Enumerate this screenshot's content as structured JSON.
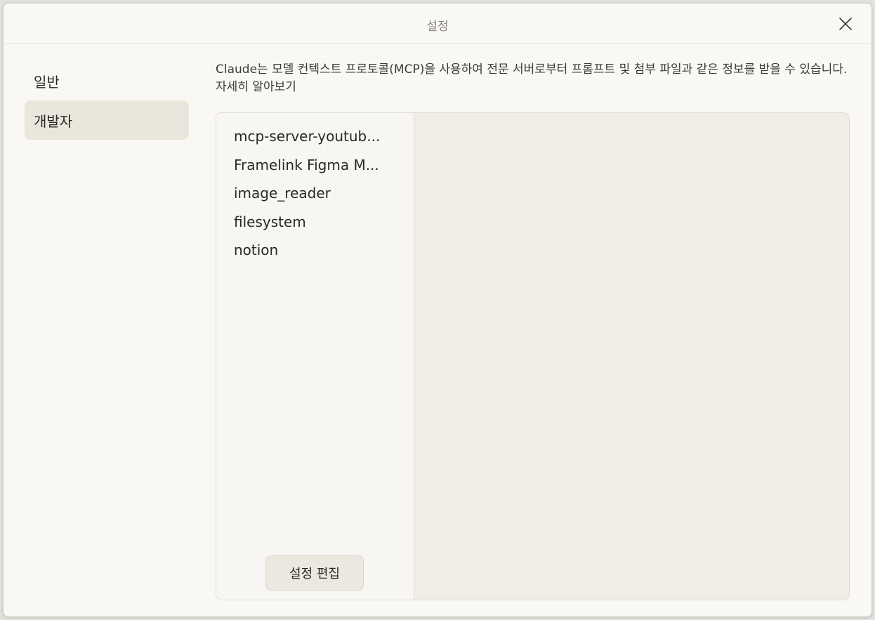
{
  "window": {
    "title": "설정"
  },
  "sidebar": {
    "items": [
      {
        "label": "일반"
      },
      {
        "label": "개발자"
      }
    ]
  },
  "description": {
    "text": "Claude는 모델 컨텍스트 프로토콜(MCP)을 사용하여 전문 서버로부터 프롬프트 및 첨부 파일과 같은 정보를 받을 수 있습니다.",
    "link": "자세히 알아보기"
  },
  "servers": [
    {
      "label": "mcp-server-youtub..."
    },
    {
      "label": "Framelink Figma M..."
    },
    {
      "label": "image_reader"
    },
    {
      "label": "filesystem"
    },
    {
      "label": "notion"
    }
  ],
  "edit_button": {
    "label": "설정 편집"
  },
  "colors": {
    "window_bg": "#f9f8f5",
    "active_item_bg": "#e9e6dc",
    "panel_bg": "#f0ede6"
  }
}
